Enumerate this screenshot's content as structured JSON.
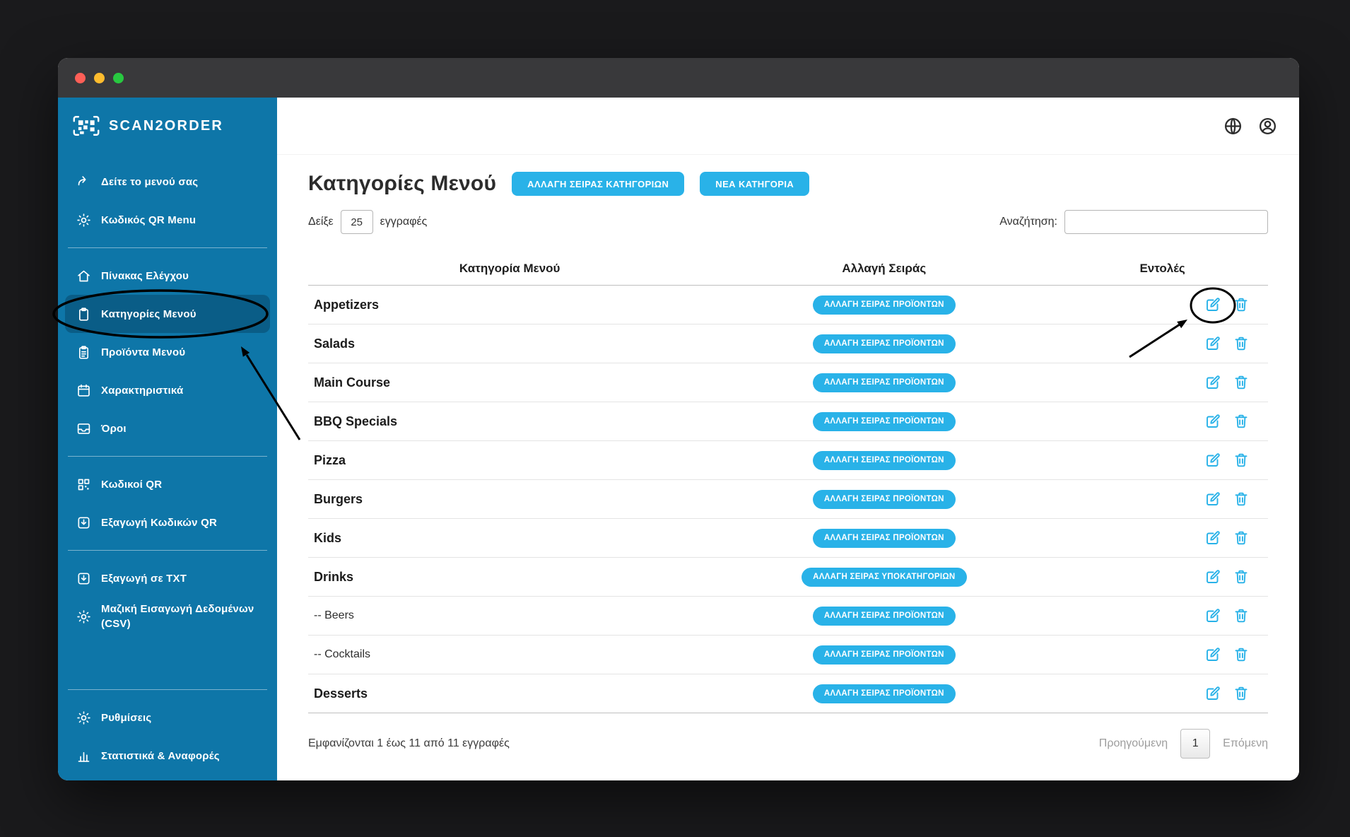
{
  "colors": {
    "accent": "#29b2e8",
    "sidebar": "#0e76a8",
    "sidebar_active": "#0a5d87"
  },
  "titlebar": {
    "lights": [
      {
        "name": "close",
        "color": "#ff5f57"
      },
      {
        "name": "minimize",
        "color": "#febc2e"
      },
      {
        "name": "zoom",
        "color": "#28c840"
      }
    ]
  },
  "brand": {
    "name": "SCAN2ORDER"
  },
  "topbar": {
    "icons": [
      {
        "name": "globe"
      },
      {
        "name": "user"
      }
    ]
  },
  "sidebar": {
    "groups": [
      {
        "items": [
          {
            "id": "view-your-menu",
            "icon": "external-link",
            "label": "Δείτε το μενού σας"
          },
          {
            "id": "qr-menu-code",
            "icon": "gear",
            "label": "Κωδικός QR Menu"
          }
        ]
      },
      {
        "items": [
          {
            "id": "dashboard",
            "icon": "home",
            "label": "Πίνακας Ελέγχου"
          },
          {
            "id": "menu-categories",
            "icon": "clipboard",
            "label": "Κατηγορίες Μενού",
            "active": true
          },
          {
            "id": "menu-products",
            "icon": "clipboard-list",
            "label": "Προϊόντα Μενού"
          },
          {
            "id": "attributes",
            "icon": "calendar",
            "label": "Χαρακτηριστικά"
          },
          {
            "id": "terms",
            "icon": "inbox",
            "label": "Όροι"
          }
        ]
      },
      {
        "items": [
          {
            "id": "qr-codes",
            "icon": "qr",
            "label": "Κωδικοί QR"
          },
          {
            "id": "export-qr-codes",
            "icon": "download",
            "label": "Εξαγωγή Κωδικών QR"
          }
        ]
      },
      {
        "items": [
          {
            "id": "export-txt",
            "icon": "download",
            "label": "Εξαγωγή σε TXT"
          },
          {
            "id": "bulk-import-csv",
            "icon": "gear",
            "label": "Μαζική Εισαγωγή Δεδομένων (CSV)"
          }
        ]
      },
      {
        "bottom": true,
        "items": [
          {
            "id": "settings",
            "icon": "gear",
            "label": "Ρυθμίσεις"
          },
          {
            "id": "statistics-reports",
            "icon": "chart",
            "label": "Στατιστικά & Αναφορές"
          }
        ]
      }
    ]
  },
  "page": {
    "title": "Κατηγορίες Μενού",
    "buttons": [
      {
        "label": "ΑΛΛΑΓΗ ΣΕΙΡΑΣ ΚΑΤΗΓΟΡΙΩΝ"
      },
      {
        "label": "ΝΕΑ ΚΑΤΗΓΟΡΙΑ"
      }
    ],
    "length_control": {
      "prefix": "Δείξε",
      "value": "25",
      "suffix": "εγγραφές"
    },
    "search": {
      "label": "Αναζήτηση:",
      "value": ""
    }
  },
  "table": {
    "headers": [
      "Κατηγορία Μενού",
      "Αλλαγή Σειράς",
      "Εντολές"
    ],
    "rows": [
      {
        "name": "Appetizers",
        "order_label": "ΑΛΛΑΓΗ ΣΕΙΡΑΣ ΠΡΟΪΟΝΤΩΝ",
        "sub": false
      },
      {
        "name": "Salads",
        "order_label": "ΑΛΛΑΓΗ ΣΕΙΡΑΣ ΠΡΟΪΟΝΤΩΝ",
        "sub": false
      },
      {
        "name": "Main Course",
        "order_label": "ΑΛΛΑΓΗ ΣΕΙΡΑΣ ΠΡΟΪΟΝΤΩΝ",
        "sub": false
      },
      {
        "name": "BBQ Specials",
        "order_label": "ΑΛΛΑΓΗ ΣΕΙΡΑΣ ΠΡΟΪΟΝΤΩΝ",
        "sub": false
      },
      {
        "name": "Pizza",
        "order_label": "ΑΛΛΑΓΗ ΣΕΙΡΑΣ ΠΡΟΪΟΝΤΩΝ",
        "sub": false
      },
      {
        "name": "Burgers",
        "order_label": "ΑΛΛΑΓΗ ΣΕΙΡΑΣ ΠΡΟΪΟΝΤΩΝ",
        "sub": false
      },
      {
        "name": "Kids",
        "order_label": "ΑΛΛΑΓΗ ΣΕΙΡΑΣ ΠΡΟΪΟΝΤΩΝ",
        "sub": false
      },
      {
        "name": "Drinks",
        "order_label": "ΑΛΛΑΓΗ ΣΕΙΡΑΣ ΥΠΟΚΑΤΗΓΟΡΙΩΝ",
        "sub": false
      },
      {
        "name": "-- Beers",
        "order_label": "ΑΛΛΑΓΗ ΣΕΙΡΑΣ ΠΡΟΪΟΝΤΩΝ",
        "sub": true
      },
      {
        "name": "-- Cocktails",
        "order_label": "ΑΛΛΑΓΗ ΣΕΙΡΑΣ ΠΡΟΪΟΝΤΩΝ",
        "sub": true
      },
      {
        "name": "Desserts",
        "order_label": "ΑΛΛΑΓΗ ΣΕΙΡΑΣ ΠΡΟΪΟΝΤΩΝ",
        "sub": false
      }
    ]
  },
  "footer": {
    "info": "Εμφανίζονται 1 έως 11 από 11 εγγραφές",
    "prev": "Προηγούμενη",
    "page": "1",
    "next": "Επόμενη"
  }
}
